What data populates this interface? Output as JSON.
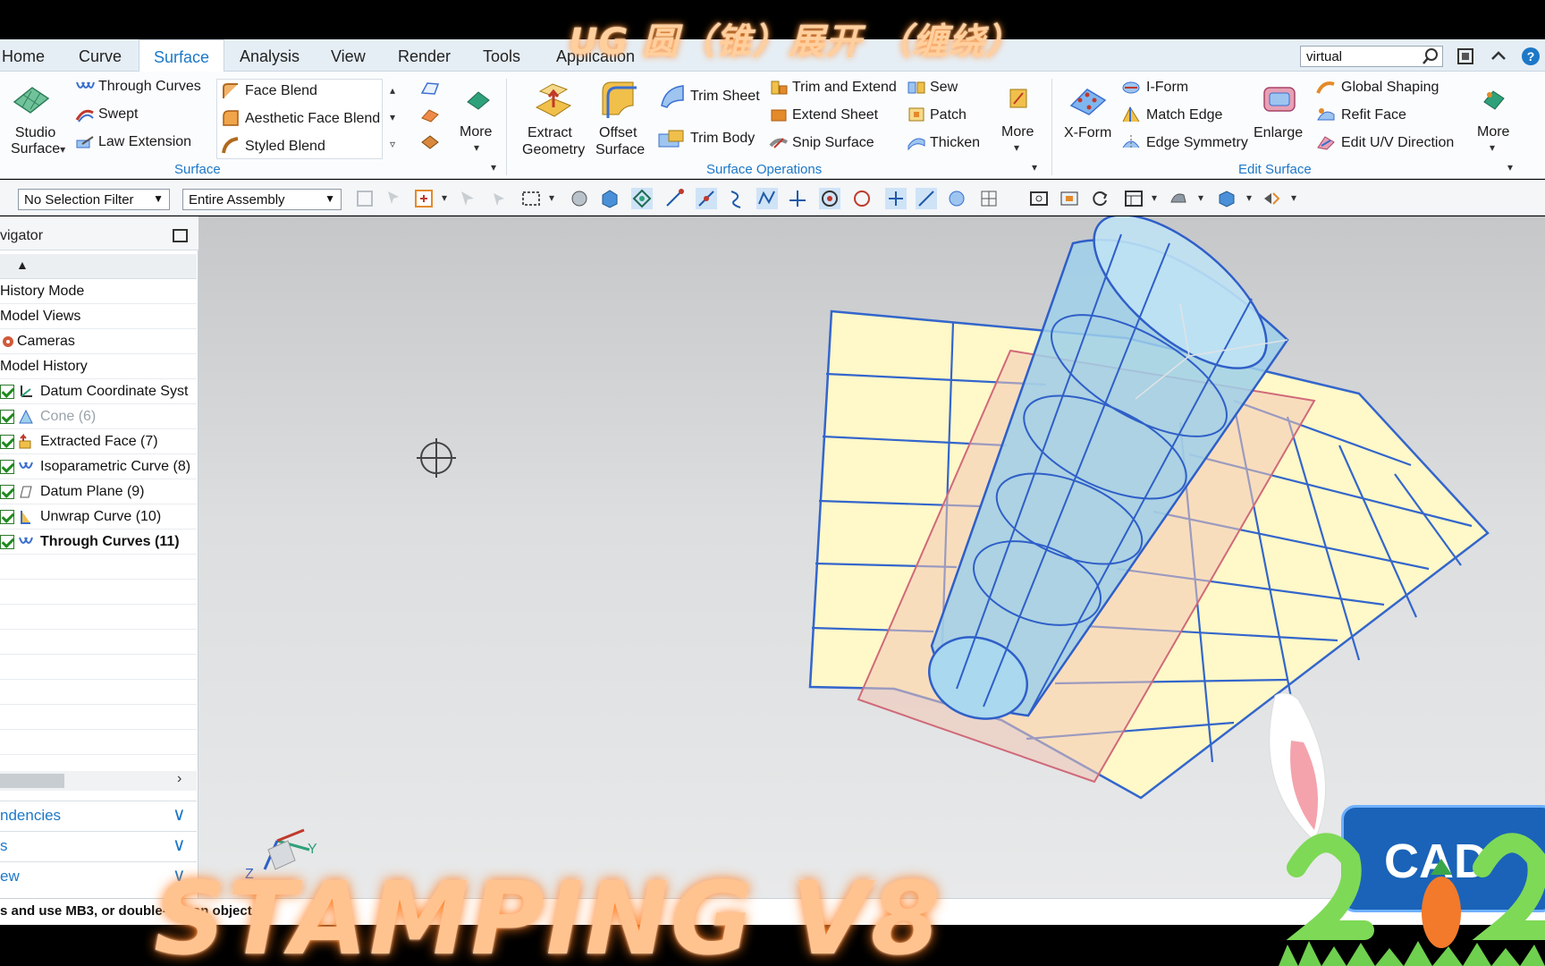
{
  "overlay": {
    "title": "UG 圆（锥）展开 （缠绕）",
    "bottom": "STAMPING V8",
    "badge": "CAD"
  },
  "menu": {
    "tabs": [
      "Home",
      "Curve",
      "Surface",
      "Analysis",
      "View",
      "Render",
      "Tools",
      "Application"
    ],
    "active": "Surface",
    "search_value": "virtual"
  },
  "ribbon": {
    "surface_group": {
      "label": "Surface",
      "studio_surface": "Studio\nSurface",
      "through_curves": "Through Curves",
      "swept": "Swept",
      "law_extension": "Law Extension",
      "face_blend": "Face Blend",
      "aesthetic_face_blend": "Aesthetic Face Blend",
      "styled_blend": "Styled Blend",
      "more": "More"
    },
    "surface_ops_group": {
      "label": "Surface Operations",
      "extract_geometry_1": "Extract",
      "extract_geometry_2": "Geometry",
      "offset_surface_1": "Offset",
      "offset_surface_2": "Surface",
      "trim_sheet": "Trim Sheet",
      "trim_body": "Trim Body",
      "trim_and_extend": "Trim and Extend",
      "extend_sheet": "Extend Sheet",
      "snip_surface": "Snip Surface",
      "sew": "Sew",
      "patch": "Patch",
      "thicken": "Thicken",
      "more": "More"
    },
    "edit_surface_group": {
      "label": "Edit Surface",
      "x_form": "X-Form",
      "i_form": "I-Form",
      "match_edge": "Match Edge",
      "edge_symmetry": "Edge Symmetry",
      "enlarge": "Enlarge",
      "global_shaping": "Global Shaping",
      "refit_face": "Refit Face",
      "edit_uv_direction": "Edit U/V Direction",
      "more": "More"
    }
  },
  "selection_bar": {
    "filter": "No Selection Filter",
    "scope": "Entire Assembly"
  },
  "navigator": {
    "title": "vigator",
    "rows": [
      {
        "label": "History Mode",
        "check": false,
        "dim": false,
        "bold": false
      },
      {
        "label": "Model Views",
        "check": false,
        "dim": false,
        "bold": false
      },
      {
        "label": "Cameras",
        "check": false,
        "dim": false,
        "bold": false
      },
      {
        "label": "Model History",
        "check": false,
        "dim": false,
        "bold": false
      },
      {
        "label": "Datum Coordinate Syst",
        "check": true,
        "dim": false,
        "bold": false
      },
      {
        "label": "Cone (6)",
        "check": true,
        "dim": true,
        "bold": false
      },
      {
        "label": "Extracted Face (7)",
        "check": true,
        "dim": false,
        "bold": false
      },
      {
        "label": "Isoparametric Curve (8)",
        "check": true,
        "dim": false,
        "bold": false
      },
      {
        "label": "Datum Plane (9)",
        "check": true,
        "dim": false,
        "bold": false
      },
      {
        "label": "Unwrap Curve (10)",
        "check": true,
        "dim": false,
        "bold": false
      },
      {
        "label": "Through Curves (11)",
        "check": true,
        "dim": false,
        "bold": true
      }
    ],
    "accordion": [
      "ndencies",
      "s",
      "ew"
    ]
  },
  "status": {
    "text": "s and use MB3, or double-cl k an object"
  },
  "triad": {
    "y": "Y",
    "z": "Z"
  },
  "colors": {
    "accent": "#1d78c8",
    "sheet_fill": "#fff8c8",
    "cone_fill": "#9fd0ea",
    "mesh_line": "#3366cc",
    "overlay_text": "#ffc390"
  }
}
